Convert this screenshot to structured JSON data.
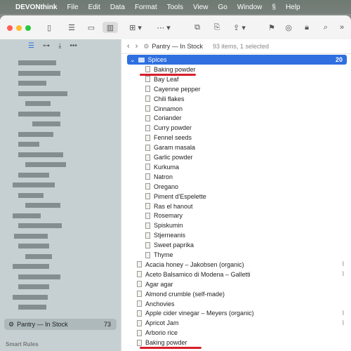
{
  "menubar": {
    "app": "DEVONthink",
    "items": [
      "File",
      "Edit",
      "Data",
      "Format",
      "Tools",
      "View",
      "Go",
      "Window",
      "Help"
    ]
  },
  "sidebar": {
    "pantry_label": "Pantry — In Stock",
    "pantry_count": "73",
    "smart_rules": "Smart Rules"
  },
  "pathbar": {
    "crumb": "Pantry — In Stock",
    "status": "93 items, 1 selected"
  },
  "group": {
    "name": "Spices",
    "count": "20",
    "items": [
      "Baking powder",
      "Bay Leaf",
      "Cayenne pepper",
      "Chili flakes",
      "Cinnamon",
      "Coriander",
      "Curry powder",
      "Fennel seeds",
      "Garam masala",
      "Garlic powder",
      "Kurkuma",
      "Natron",
      "Oregano",
      "Piment d'Espelette",
      "Ras el hanout",
      "Rosemary",
      "Spiskumin",
      "Stjerneanis",
      "Sweet paprika",
      "Thyme"
    ]
  },
  "top_items": [
    {
      "name": "Acacia honey – Jakobsen (organic)",
      "clip": true
    },
    {
      "name": "Aceto Balsamico di Modena – Galletti",
      "clip": true
    },
    {
      "name": "Agar agar",
      "clip": false
    },
    {
      "name": "Almond crumble (self-made)",
      "clip": false
    },
    {
      "name": "Anchovies",
      "clip": false
    },
    {
      "name": "Apple cider vinegar – Meyers (organic)",
      "clip": true
    },
    {
      "name": "Apricot Jam",
      "clip": true
    },
    {
      "name": "Arborio rice",
      "clip": false
    },
    {
      "name": "Baking powder",
      "clip": false
    }
  ],
  "colors": {
    "accent": "#2f6fe0",
    "annotation": "#d81e2a",
    "sidebar": "#c6d0d2"
  }
}
